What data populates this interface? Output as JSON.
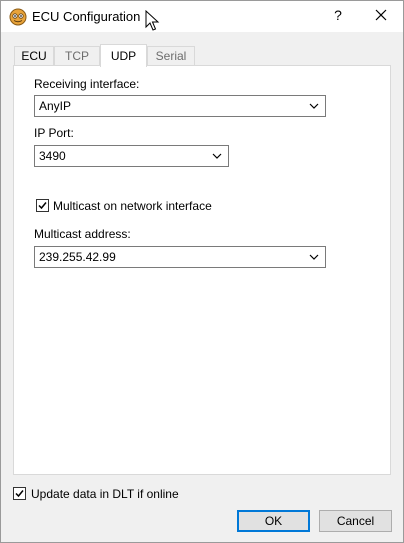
{
  "window": {
    "title": "ECU Configuration",
    "help_glyph": "?",
    "icons": {
      "app": "app-icon",
      "close": "close-icon",
      "cursor": "mouse-cursor-icon"
    }
  },
  "tabs": [
    {
      "label": "ECU",
      "state": "enabled"
    },
    {
      "label": "TCP",
      "state": "disabled"
    },
    {
      "label": "UDP",
      "state": "active"
    },
    {
      "label": "Serial",
      "state": "disabled"
    }
  ],
  "udp": {
    "receiving_interface_label": "Receiving interface:",
    "receiving_interface_value": "AnyIP",
    "ip_port_label": "IP Port:",
    "ip_port_value": "3490",
    "multicast_checkbox_label": "Multicast on network interface",
    "multicast_checked": true,
    "multicast_address_label": "Multicast address:",
    "multicast_address_value": "239.255.42.99"
  },
  "footer": {
    "update_checkbox_label": "Update data in DLT if online",
    "update_checked": true,
    "ok_label": "OK",
    "cancel_label": "Cancel"
  },
  "colors": {
    "default_button_border": "#0078d7",
    "panel_background": "#ffffff",
    "dialog_background": "#f0f0f0"
  }
}
